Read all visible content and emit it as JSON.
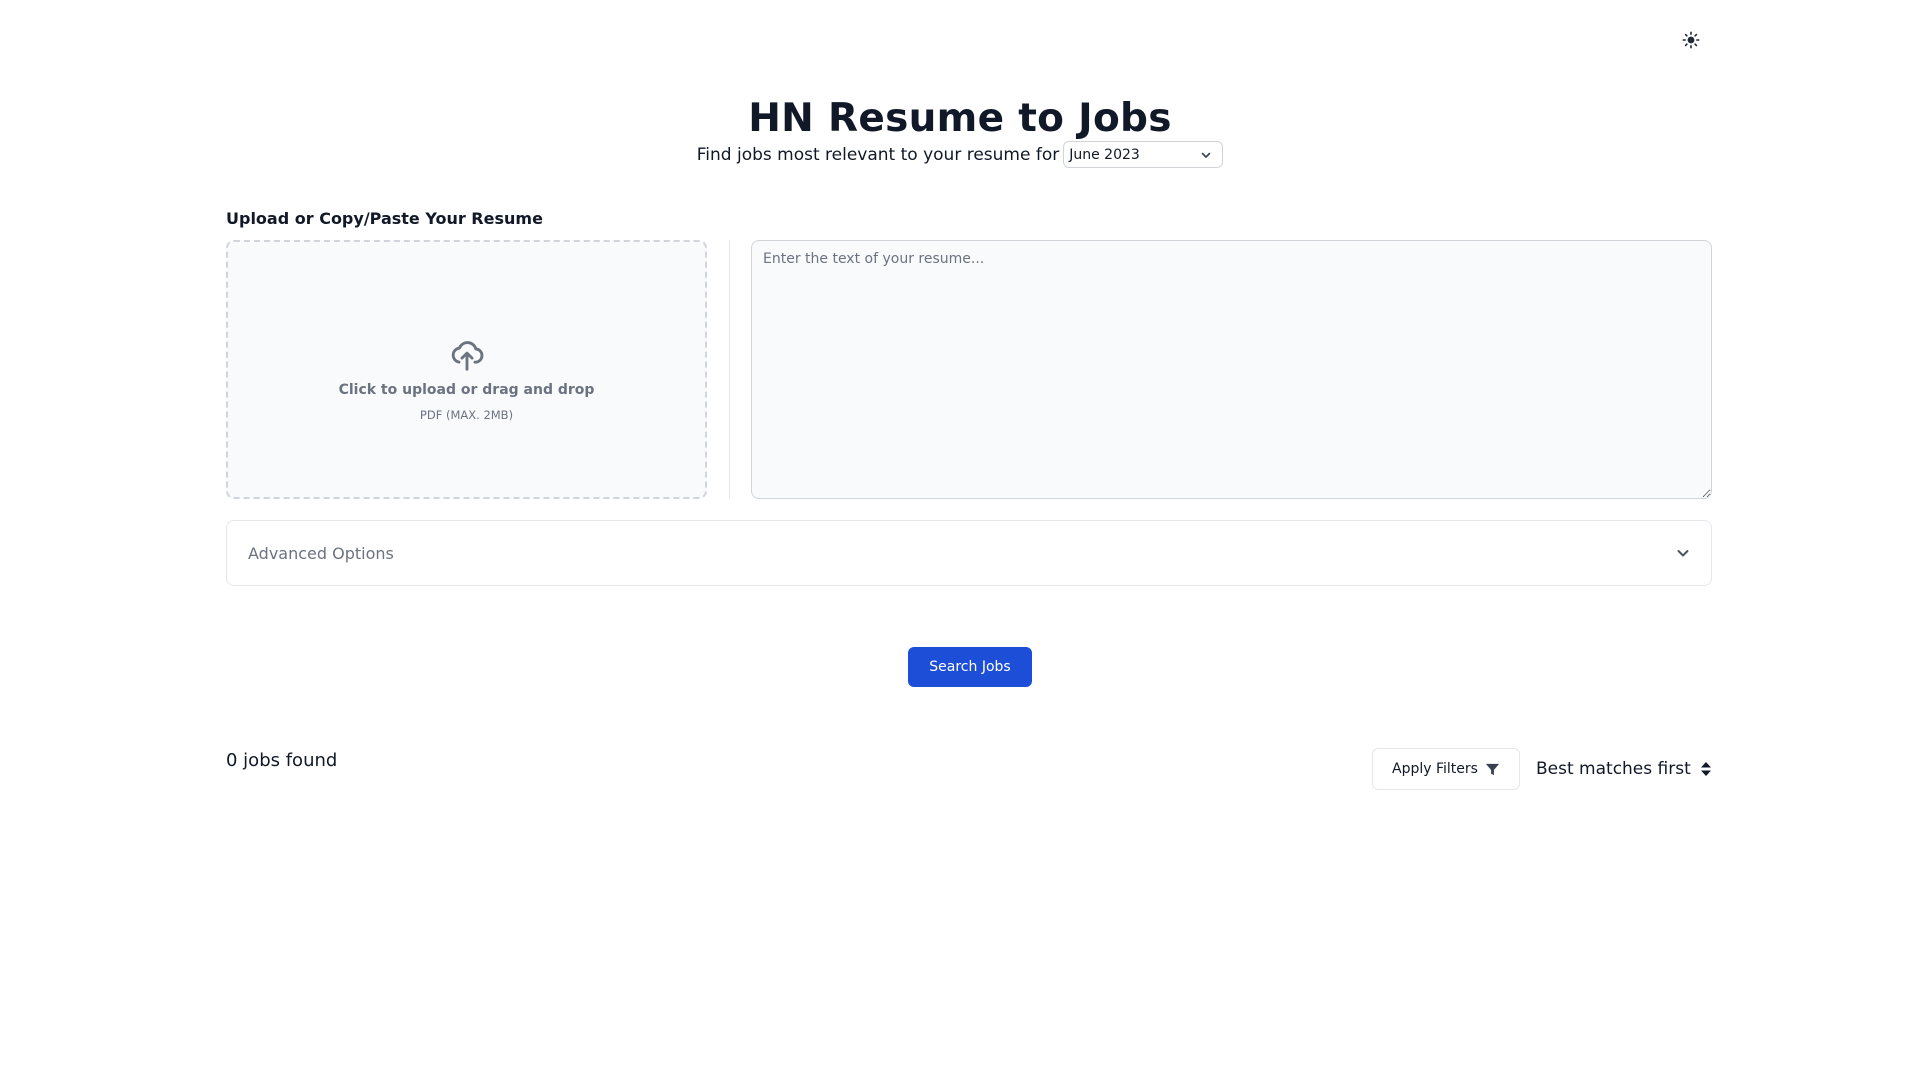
{
  "header": {
    "title": "HN Resume to Jobs",
    "subtitle": "Find jobs most relevant to your resume for",
    "month_selected": "June 2023",
    "theme_toggle_icon": "sun-icon"
  },
  "upload": {
    "section_label": "Upload or Copy/Paste Your Resume",
    "dropzone_main": "Click to upload or drag and drop",
    "dropzone_sub": "PDF (MAX. 2MB)",
    "textarea_placeholder": "Enter the text of your resume..."
  },
  "advanced": {
    "label": "Advanced Options"
  },
  "actions": {
    "search_label": "Search Jobs"
  },
  "results": {
    "count_text": "0 jobs found",
    "filters_label": "Apply Filters",
    "sort_label": "Best matches first"
  },
  "colors": {
    "primary": "#1d4ed8",
    "text": "#111827",
    "muted": "#6b7280",
    "border": "#d1d5db"
  }
}
